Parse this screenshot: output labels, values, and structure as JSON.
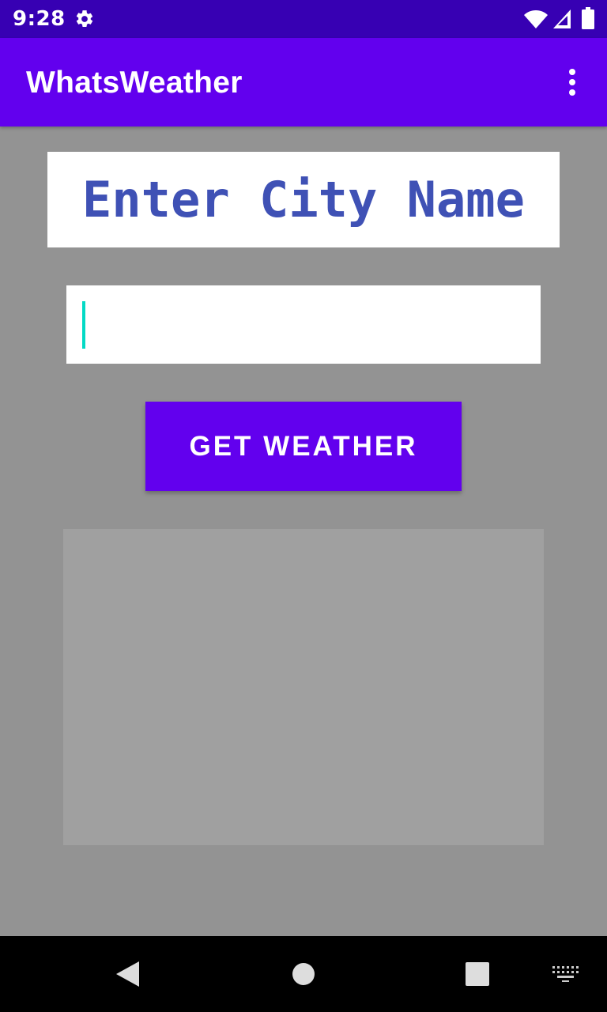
{
  "status_bar": {
    "time": "9:28",
    "icons": [
      "gear-icon",
      "wifi-icon",
      "signal-icon",
      "battery-icon"
    ]
  },
  "app_bar": {
    "title": "WhatsWeather",
    "menu_icon": "overflow-icon"
  },
  "main": {
    "heading": "Enter City Name",
    "city_input": {
      "value": "",
      "placeholder": ""
    },
    "button_label": "GET WEATHER"
  },
  "nav_bar": {
    "icons": [
      "back-icon",
      "home-icon",
      "recents-icon",
      "keyboard-icon"
    ]
  },
  "colors": {
    "status_bar": "#3700b3",
    "primary": "#6200ee",
    "background": "#939393",
    "heading_text": "#3f51b5",
    "cursor": "#03dac5",
    "result_panel": "#a0a0a0"
  }
}
